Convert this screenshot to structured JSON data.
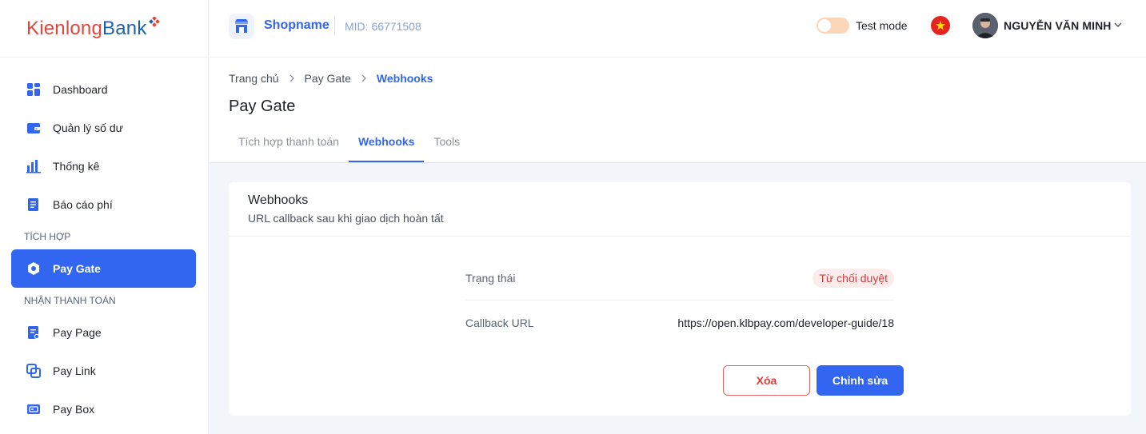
{
  "brand": {
    "logo_part1": "Kienlong",
    "logo_part2": "Bank"
  },
  "sidebar": {
    "items": [
      {
        "label": "Dashboard"
      },
      {
        "label": "Quản lý số dư"
      },
      {
        "label": "Thống kê"
      },
      {
        "label": "Báo cáo phí"
      }
    ],
    "section_integration": "TÍCH HỢP",
    "active_item": {
      "label": "Pay Gate"
    },
    "section_payments": "NHẬN THANH TOÁN",
    "payment_items": [
      {
        "label": "Pay Page"
      },
      {
        "label": "Pay Link"
      },
      {
        "label": "Pay Box"
      }
    ]
  },
  "header": {
    "shop_name": "Shopname",
    "mid": "MID: 66771508",
    "test_mode_label": "Test mode",
    "user_name": "NGUYỄN VĂN MINH"
  },
  "breadcrumb": {
    "home": "Trang chủ",
    "parent": "Pay Gate",
    "current": "Webhooks"
  },
  "page": {
    "title": "Pay Gate",
    "tabs": [
      {
        "label": "Tích hợp thanh toán"
      },
      {
        "label": "Webhooks"
      },
      {
        "label": "Tools"
      }
    ]
  },
  "card": {
    "title": "Webhooks",
    "subtitle": "URL callback sau khi giao dịch hoàn tất",
    "status_label": "Trạng thái",
    "status_value": "Từ chối duyệt",
    "callback_label": "Callback URL",
    "callback_value": "https://open.klbpay.com/developer-guide/18",
    "delete_label": "Xóa",
    "edit_label": "Chỉnh sửa"
  },
  "colors": {
    "accent": "#3266f0",
    "danger": "#d83a3a",
    "brand_red": "#e2463a",
    "brand_blue": "#1b5fb0"
  }
}
